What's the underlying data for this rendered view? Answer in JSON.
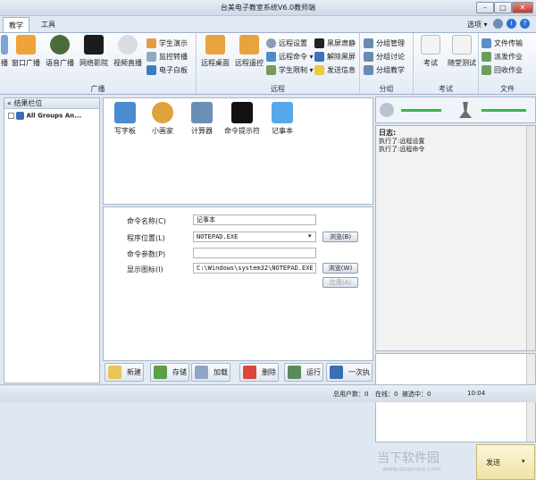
{
  "window": {
    "title": "台美电子教室系统V6.0教师端"
  },
  "tabs": [
    {
      "label": "教学",
      "active": true
    },
    {
      "label": "工具",
      "active": false
    }
  ],
  "header_right": {
    "options_label": "选项 ▾"
  },
  "ribbon": {
    "broadcast": {
      "label": "广播",
      "buttons": [
        "播",
        "窗口广播",
        "语音广播",
        "网络影院",
        "视频直播"
      ],
      "small": [
        "学生演示",
        "监控转播",
        "电子白板"
      ]
    },
    "remote": {
      "label": "远程",
      "buttons": [
        "远程桌面",
        "远程遥控"
      ],
      "small": [
        "远程设置",
        "远程命令 ▾",
        "学生限制 ▾",
        "黑屏肃静",
        "解除黑屏",
        "发送信息"
      ]
    },
    "group": {
      "label": "分组",
      "small": [
        "分组管理",
        "分组讨论",
        "分组教学"
      ]
    },
    "exam": {
      "label": "考试",
      "buttons": [
        "考试",
        "随堂测试"
      ]
    },
    "file": {
      "label": "文件",
      "small": [
        "文件传输",
        "派发作业",
        "回收作业"
      ]
    }
  },
  "left_panel": {
    "header": "« 结果栏位",
    "tree_item": "All Groups An..."
  },
  "apps": [
    {
      "label": "写字板",
      "icon": "wordpad-icon",
      "color": "#4a8ad0"
    },
    {
      "label": "小画家",
      "icon": "paint-icon",
      "color": "#e0a23a"
    },
    {
      "label": "计算器",
      "icon": "calculator-icon",
      "color": "#6a8fb4"
    },
    {
      "label": "命令提示符",
      "icon": "cmd-icon",
      "color": "#111111"
    },
    {
      "label": "记事本",
      "icon": "notepad-icon",
      "color": "#57a8e8"
    }
  ],
  "command_form": {
    "name_label": "命令名称(C)",
    "name_value": "记事本",
    "path_label": "程序位置(L)",
    "path_value": "NOTEPAD.EXE",
    "params_label": "命令参数(P)",
    "params_value": "",
    "icon_label": "显示图标(I)",
    "icon_value": "C:\\Windows\\system32\\NOTEPAD.EXE",
    "browse1": "浏览(B)",
    "browse2": "浏览(W)",
    "apply": "应用(A)"
  },
  "actions": [
    "新建",
    "存储",
    "加载",
    "删除",
    "运行",
    "一次执行"
  ],
  "log": {
    "title": "日志:",
    "lines": [
      "执行了:远程设置",
      "执行了:远程命令"
    ]
  },
  "send": {
    "label": "发送"
  },
  "status": {
    "users": "总用户数：0",
    "online": "在线：0",
    "selected": "被选中：0",
    "time": "10:04"
  },
  "watermark": "当下软件园",
  "watermark_url": "www.downxia.com",
  "colors": {
    "accent": "#3b6fb5",
    "ribbon_bg": "#e3ebf5"
  }
}
